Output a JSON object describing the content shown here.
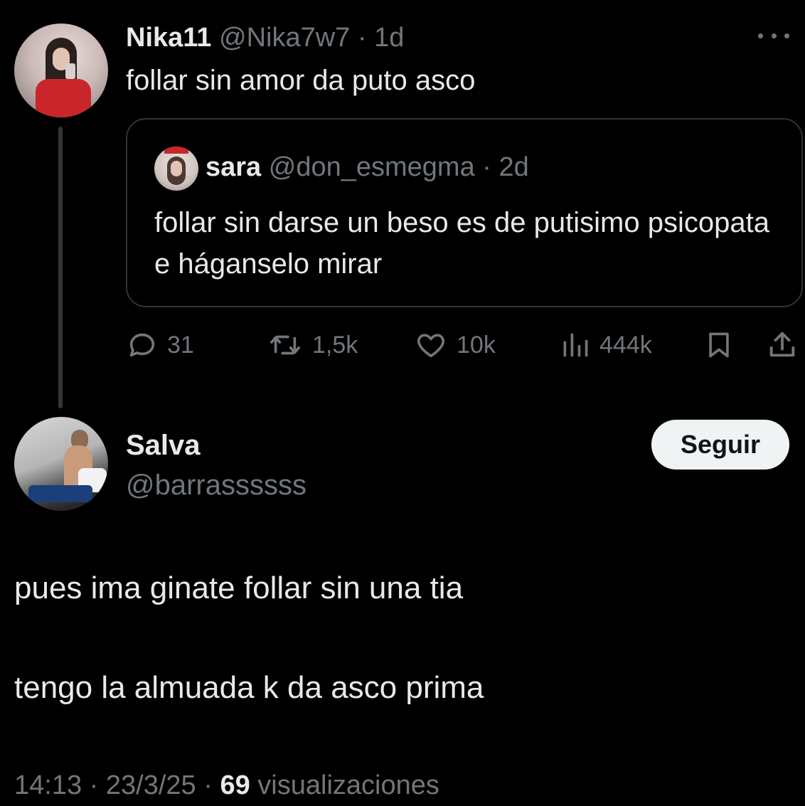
{
  "original_tweet": {
    "display_name": "Nika11",
    "handle": "@Nika7w7",
    "separator": "·",
    "age": "1d",
    "text": "follar sin amor da puto asco",
    "more_icon": "ellipsis-icon"
  },
  "quoted_tweet": {
    "display_name": "sara",
    "handle": "@don_esmegma",
    "separator": "·",
    "age": "2d",
    "text": "follar sin darse un beso es de putisimo psicopata e háganselo mirar"
  },
  "actions": {
    "replies": "31",
    "reposts": "1,5k",
    "likes": "10k",
    "views": "444k"
  },
  "reply": {
    "display_name": "Salva",
    "handle": "@barrassssss",
    "follow_label": "Seguir",
    "line1": "pues ima ginate follar sin una tia",
    "line2": "tengo la almuada k da asco prima"
  },
  "meta": {
    "time": "14:13",
    "sep1": " · ",
    "date": "23/3/25",
    "sep2": " · ",
    "views_count": "69",
    "views_label": " visualizaciones"
  },
  "colors": {
    "background": "#000000",
    "text": "#e7e9ea",
    "muted": "#71767b",
    "border": "#2f3336",
    "button_bg": "#eff3f4"
  }
}
